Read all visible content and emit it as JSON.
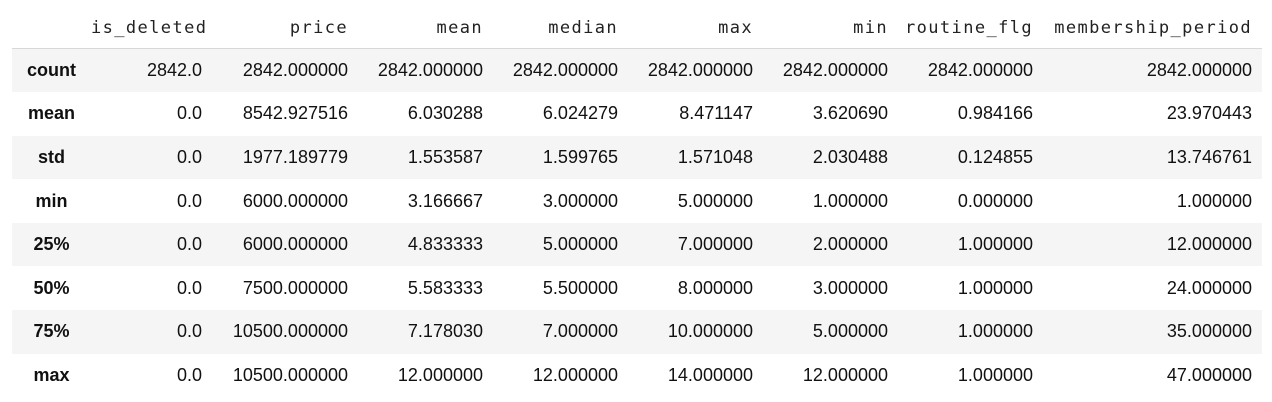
{
  "table": {
    "columns": [
      "is_deleted",
      "price",
      "mean",
      "median",
      "max",
      "min",
      "routine_flg",
      "membership_period"
    ],
    "rows": [
      {
        "label": "count",
        "values": [
          "2842.0",
          "2842.000000",
          "2842.000000",
          "2842.000000",
          "2842.000000",
          "2842.000000",
          "2842.000000",
          "2842.000000"
        ]
      },
      {
        "label": "mean",
        "values": [
          "0.0",
          "8542.927516",
          "6.030288",
          "6.024279",
          "8.471147",
          "3.620690",
          "0.984166",
          "23.970443"
        ]
      },
      {
        "label": "std",
        "values": [
          "0.0",
          "1977.189779",
          "1.553587",
          "1.599765",
          "1.571048",
          "2.030488",
          "0.124855",
          "13.746761"
        ]
      },
      {
        "label": "min",
        "values": [
          "0.0",
          "6000.000000",
          "3.166667",
          "3.000000",
          "5.000000",
          "1.000000",
          "0.000000",
          "1.000000"
        ]
      },
      {
        "label": "25%",
        "values": [
          "0.0",
          "6000.000000",
          "4.833333",
          "5.000000",
          "7.000000",
          "2.000000",
          "1.000000",
          "12.000000"
        ]
      },
      {
        "label": "50%",
        "values": [
          "0.0",
          "7500.000000",
          "5.583333",
          "5.500000",
          "8.000000",
          "3.000000",
          "1.000000",
          "24.000000"
        ]
      },
      {
        "label": "75%",
        "values": [
          "0.0",
          "10500.000000",
          "7.178030",
          "7.000000",
          "10.000000",
          "5.000000",
          "1.000000",
          "35.000000"
        ]
      },
      {
        "label": "max",
        "values": [
          "0.0",
          "10500.000000",
          "12.000000",
          "12.000000",
          "14.000000",
          "12.000000",
          "1.000000",
          "47.000000"
        ]
      }
    ]
  }
}
